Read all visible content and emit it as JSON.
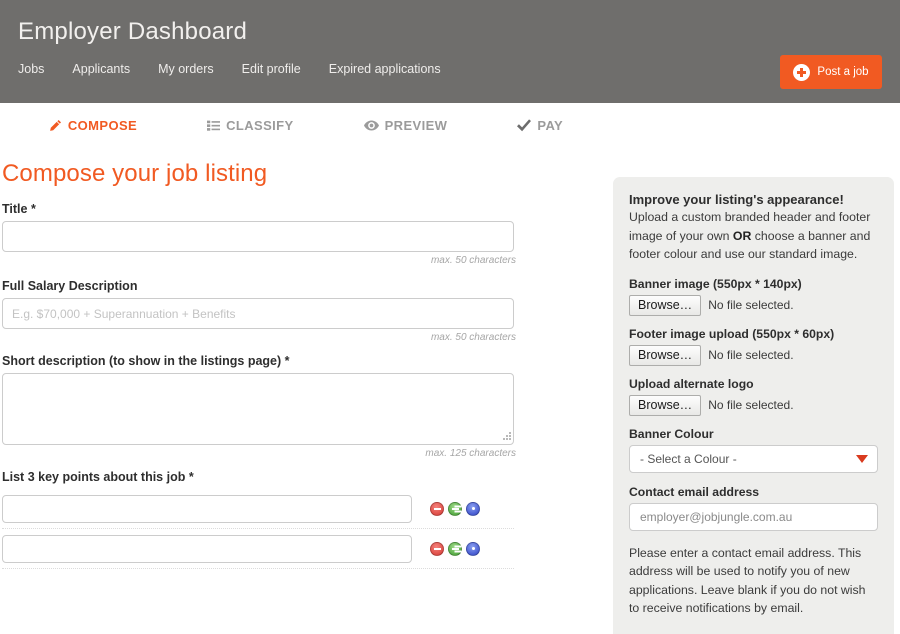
{
  "header": {
    "title": "Employer Dashboard",
    "nav": [
      {
        "label": "Jobs",
        "name": "nav-item-jobs"
      },
      {
        "label": "Applicants",
        "name": "nav-item-applicants"
      },
      {
        "label": "My orders",
        "name": "nav-item-my-orders"
      },
      {
        "label": "Edit profile",
        "name": "nav-item-edit-profile"
      },
      {
        "label": "Expired applications",
        "name": "nav-item-expired-applications"
      }
    ],
    "post_job_label": "Post a job",
    "background_color": "#6f6e6c",
    "accent_color": "#f15a22"
  },
  "tabs": [
    {
      "label": "COMPOSE",
      "icon": "pencil-icon",
      "active": true
    },
    {
      "label": "CLASSIFY",
      "icon": "list-icon",
      "active": false
    },
    {
      "label": "PREVIEW",
      "icon": "eye-icon",
      "active": false
    },
    {
      "label": "PAY",
      "icon": "check-icon",
      "active": false
    }
  ],
  "main": {
    "page_title": "Compose your job listing",
    "title_field": {
      "label": "Title *",
      "value": "",
      "placeholder": "",
      "hint": "max. 50 characters"
    },
    "salary_field": {
      "label": "Full Salary Description",
      "value": "",
      "placeholder": "E.g. $70,000 + Superannuation + Benefits",
      "hint": "max. 50 characters"
    },
    "short_description": {
      "label": "Short description (to show in the listings page) *",
      "value": "",
      "placeholder": "",
      "hint": "max. 125 characters"
    },
    "key_points": {
      "label": "List 3 key points about this job *",
      "rows": [
        {
          "value": "",
          "placeholder": ""
        },
        {
          "value": "",
          "placeholder": ""
        }
      ],
      "actions": [
        {
          "name": "remove-key-point-button",
          "kind": "remove",
          "color": "#e0504a"
        },
        {
          "name": "add-key-point-button",
          "kind": "add",
          "color": "#5cb04a"
        },
        {
          "name": "key-point-info-button",
          "kind": "info",
          "color": "#4a5fd4"
        }
      ]
    }
  },
  "sidebar": {
    "heading": "Improve your listing's appearance!",
    "intro_part1": "Upload a custom branded header and footer image of your own ",
    "intro_strong": "OR",
    "intro_part2": " choose a banner and footer colour and use our standard image.",
    "banner_image": {
      "label": "Banner image (550px * 140px)",
      "browse_label": "Browse…",
      "status": "No file selected."
    },
    "footer_image": {
      "label": "Footer image upload (550px * 60px)",
      "browse_label": "Browse…",
      "status": "No file selected."
    },
    "alternate_logo": {
      "label": "Upload alternate logo",
      "browse_label": "Browse…",
      "status": "No file selected."
    },
    "banner_colour": {
      "label": "Banner Colour",
      "selected": "- Select a Colour -"
    },
    "contact_email": {
      "label": "Contact email address",
      "value": "",
      "placeholder": "employer@jobjungle.com.au"
    },
    "note": "Please enter a contact email address. This address will be used to notify you of new applications. Leave blank if you do not wish to receive notifications by email."
  }
}
